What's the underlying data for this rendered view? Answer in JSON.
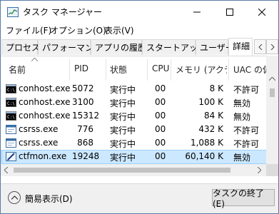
{
  "window": {
    "title": "タスク マネージャー",
    "controls": {
      "minimize": "—",
      "maximize": "☐",
      "close": "✕"
    }
  },
  "menu": [
    "ファイル(F)",
    "オプション(O)",
    "表示(V)"
  ],
  "tabs": [
    "プロセス",
    "パフォーマンス",
    "アプリの履歴",
    "スタートアップ",
    "ユーザー",
    "詳細"
  ],
  "active_tab": "詳細",
  "columns": [
    "名前",
    "PID",
    "状態",
    "CPU",
    "メモリ (アクテ...",
    "UAC の仮..."
  ],
  "rows": [
    {
      "name": "conhost.exe",
      "pid": "5072",
      "status": "実行中",
      "cpu": "00",
      "mem": "8 K",
      "uac": "不許可",
      "icon": "console-icon"
    },
    {
      "name": "conhost.exe",
      "pid": "3100",
      "status": "実行中",
      "cpu": "00",
      "mem": "100 K",
      "uac": "無効",
      "icon": "console-icon"
    },
    {
      "name": "conhost.exe",
      "pid": "15312",
      "status": "実行中",
      "cpu": "00",
      "mem": "84 K",
      "uac": "無効",
      "icon": "console-icon"
    },
    {
      "name": "csrss.exe",
      "pid": "776",
      "status": "実行中",
      "cpu": "00",
      "mem": "432 K",
      "uac": "不許可",
      "icon": "window-icon"
    },
    {
      "name": "csrss.exe",
      "pid": "868",
      "status": "実行中",
      "cpu": "00",
      "mem": "1,088 K",
      "uac": "不許可",
      "icon": "window-icon"
    },
    {
      "name": "ctfmon.exe",
      "pid": "19248",
      "status": "実行中",
      "cpu": "00",
      "mem": "60,140 K",
      "uac": "無効",
      "icon": "pen-icon",
      "selected": true
    }
  ],
  "footer": {
    "fewer_details": "簡易表示(D)",
    "end_task": "タスクの終了(E)"
  },
  "colors": {
    "selection": "#cce8ff",
    "selection_border": "#99d1ff",
    "accent": "#0078d7"
  }
}
